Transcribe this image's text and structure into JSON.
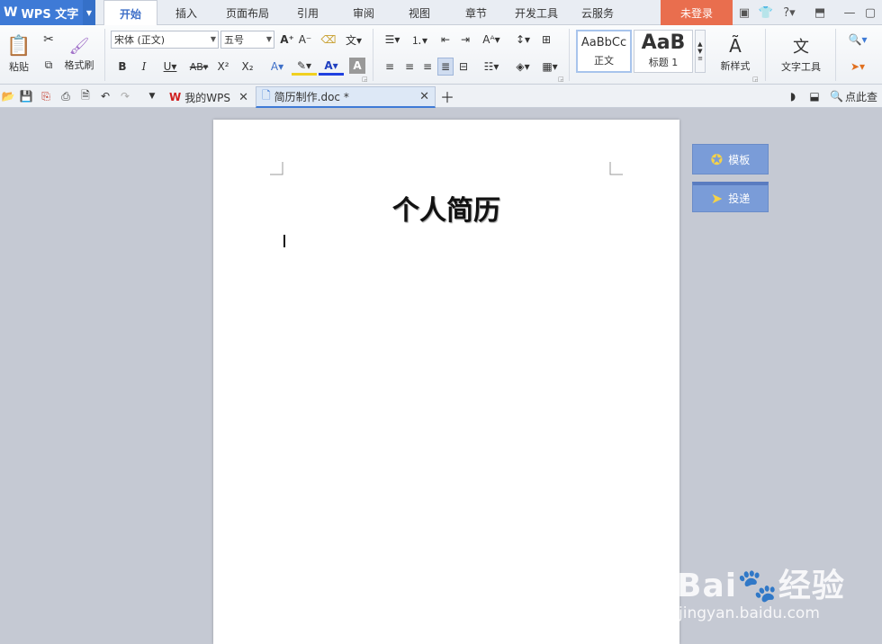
{
  "app": {
    "name": "WPS 文字"
  },
  "menu": {
    "tabs": [
      "开始",
      "插入",
      "页面布局",
      "引用",
      "审阅",
      "视图",
      "章节",
      "开发工具",
      "云服务"
    ],
    "login": "未登录"
  },
  "ribbon": {
    "paste": "粘贴",
    "format_painter": "格式刷",
    "font_name": "宋体 (正文)",
    "font_size": "五号",
    "styles": [
      {
        "preview": "AaBbCc",
        "name": "正文"
      },
      {
        "preview": "AaB",
        "name": "标题 1"
      }
    ],
    "new_style": "新样式",
    "text_tools": "文字工具"
  },
  "tabbar": {
    "tabs": [
      {
        "label": "我的WPS"
      },
      {
        "label": "简历制作.doc *"
      }
    ],
    "search": "点此查"
  },
  "document": {
    "title": "个人简历"
  },
  "sidebar": {
    "template": "模板",
    "submit": "投递"
  },
  "watermark": {
    "brand": "Bai",
    "brand2": "经验",
    "url": "jingyan.baidu.com"
  },
  "colors": {
    "accent": "#3e7ad6",
    "login": "#e96e4e",
    "side_button": "#7a9cd8"
  }
}
